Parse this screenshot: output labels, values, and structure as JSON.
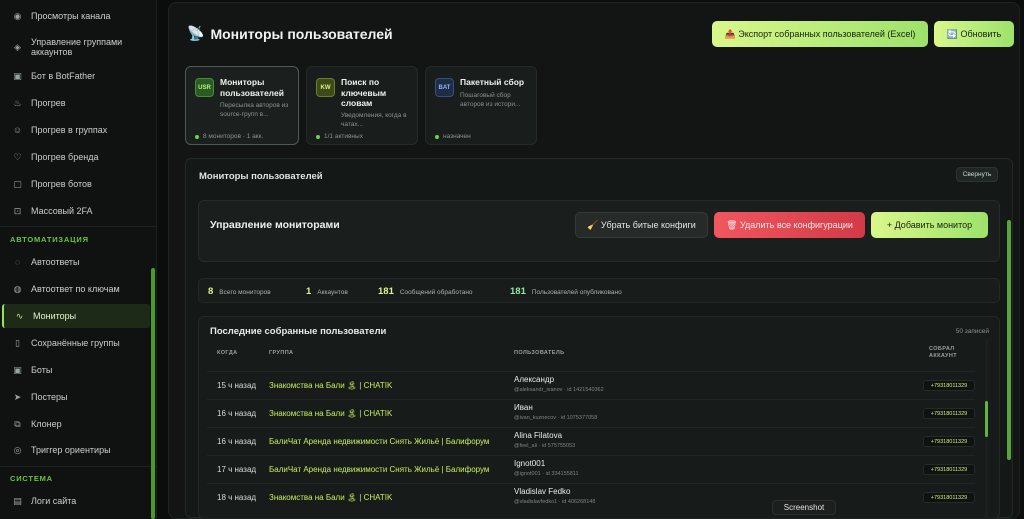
{
  "sidebar": {
    "items_top": [
      {
        "label": "Просмотры канала",
        "icon": "eye-icon"
      },
      {
        "label": "Управление группами аккаунтов",
        "icon": "layers-icon"
      },
      {
        "label": "Бот в BotFather",
        "icon": "bot-icon"
      },
      {
        "label": "Прогрев",
        "icon": "flame-icon"
      },
      {
        "label": "Прогрев в группах",
        "icon": "users-icon"
      },
      {
        "label": "Прогрев бренда",
        "icon": "heart-icon"
      },
      {
        "label": "Прогрев ботов",
        "icon": "box-icon"
      },
      {
        "label": "Массовый 2FA",
        "icon": "lock-icon"
      }
    ],
    "section_automation": "АВТОМАТИЗАЦИЯ",
    "items_automation": [
      {
        "label": "Автоответы",
        "icon": "chat-icon"
      },
      {
        "label": "Автоответ по ключам",
        "icon": "chat-key-icon"
      },
      {
        "label": "Мониторы",
        "icon": "pulse-icon",
        "active": true
      },
      {
        "label": "Сохранённые группы",
        "icon": "bookmark-icon"
      },
      {
        "label": "Боты",
        "icon": "bot-icon"
      },
      {
        "label": "Постеры",
        "icon": "send-icon"
      },
      {
        "label": "Клонер",
        "icon": "copy-icon"
      },
      {
        "label": "Триггер ориентиры",
        "icon": "target-icon"
      }
    ],
    "section_system": "СИСТЕМА",
    "items_system": [
      {
        "label": "Логи сайта",
        "icon": "log-icon"
      }
    ]
  },
  "header": {
    "title_icon": "📡",
    "title": "Мониторы пользователей",
    "export_label": "📤 Экспорт собранных пользователей (Excel)",
    "refresh_label": "🔄 Обновить"
  },
  "tiles": [
    {
      "badge": "USR",
      "title": "Мониторы пользователей",
      "desc": "Пересылка авторов из source-групп в...",
      "status": "8 мониторов · 1 акк."
    },
    {
      "badge": "KW",
      "title": "Поиск по ключевым словам",
      "desc": "Уведомления, когда в чатах...",
      "status": "1/1 активных"
    },
    {
      "badge": "BAT",
      "title": "Пакетный сбор",
      "desc": "Пошаговый сбор авторов из истори...",
      "status": "назначен"
    }
  ],
  "section": {
    "title": "Мониторы пользователей",
    "collapse_label": "Свернуть",
    "mgmt_title": "Управление мониторами",
    "btn_fix": "🧹 Убрать битые конфиги",
    "btn_delete": "🗑 Удалить все конфигурации",
    "btn_add": "+ Добавить монитор"
  },
  "stats": [
    {
      "num": "8",
      "label": "Всего мониторов"
    },
    {
      "num": "1",
      "label": "Аккаунтов"
    },
    {
      "num": "181",
      "label": "Сообщений обработано"
    },
    {
      "num": "181",
      "label": "Пользователей опубликовано"
    }
  ],
  "users": {
    "title": "Последние собранные пользователи",
    "count": "50 записей",
    "headers": {
      "when": "КОГДА",
      "group": "ГРУППА",
      "user": "ПОЛЬЗОВАТЕЛЬ",
      "account": "СОБРАЛ АККАУНТ"
    },
    "rows": [
      {
        "when": "15 ч назад",
        "group": "Знакомства на Бали 🏝 | CHATIK",
        "name": "Александр",
        "info": "@aleksandr_ivanov · id 1421540362",
        "account": "+79318011329"
      },
      {
        "when": "16 ч назад",
        "group": "Знакомства на Бали 🏝 | CHATIK",
        "name": "Иван",
        "info": "@ivan_kuznecov · id 1075377058",
        "account": "+79318011329"
      },
      {
        "when": "16 ч назад",
        "group": "БалиЧат Аренда недвижимости Снять Жильё | Балифорум",
        "name": "Alina Filatova",
        "info": "@feel_ali · id 575755053",
        "account": "+79318011329"
      },
      {
        "when": "17 ч назад",
        "group": "БалиЧат Аренда недвижимости Снять Жильё | Балифорум",
        "name": "Ignot001",
        "info": "@ignot001 · id 334155811",
        "account": "+79318011329"
      },
      {
        "when": "18 ч назад",
        "group": "Знакомства на Бали 🏝 | CHATIK",
        "name": "Vladislav Fedko",
        "info": "@vladislavfedko1 · id 406268148",
        "account": "+79318011329"
      }
    ]
  },
  "screenshot_label": "Screenshot"
}
